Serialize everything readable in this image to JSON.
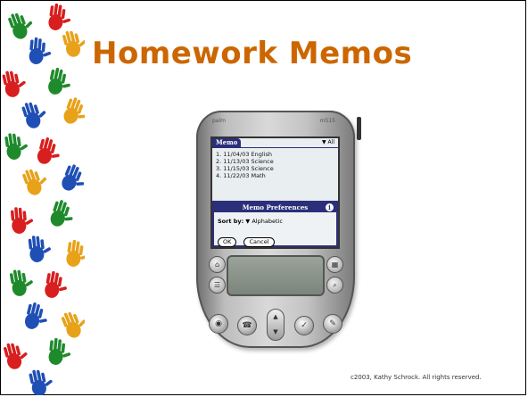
{
  "slide": {
    "title": "Homework Memos",
    "copyright": "c2003, Kathy Schrock. All rights reserved."
  },
  "device": {
    "brand_left": "palm",
    "brand_right": "m515",
    "app": {
      "tab_label": "Memo",
      "category": "▼ All",
      "memos": [
        "1. 11/04/03 English",
        "2. 11/13/03 Science",
        "3. 11/15/03 Science",
        "4. 11/22/03 Math"
      ],
      "dialog": {
        "title": "Memo Preferences",
        "sort_label": "Sort by:",
        "sort_value": "▼ Alphabetic",
        "ok_label": "OK",
        "cancel_label": "Cancel"
      }
    }
  },
  "colors": {
    "title": "#cc6600",
    "palm_header": "#2b2f7a"
  }
}
